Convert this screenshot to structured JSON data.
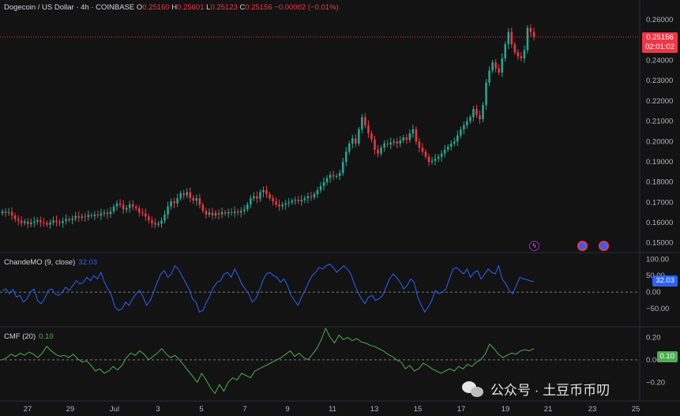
{
  "header": {
    "symbol": "Dogecoin / US Dollar · 4h · COINBASE",
    "o_label": "O",
    "o_value": "0.25160",
    "h_label": "H",
    "h_value": "0.25601",
    "l_label": "L",
    "l_value": "0.25123",
    "c_label": "C",
    "c_value": "0.25156",
    "change": "−0.00002 (−0.01%)"
  },
  "price_badge": {
    "price": "0.25156",
    "countdown": "02:01:02"
  },
  "chande": {
    "label": "ChandeMO (9, close)",
    "value": "32.03"
  },
  "cmf": {
    "label": "CMF (20)",
    "value": "0.10"
  },
  "watermark": "公众号 · 土豆币币叨",
  "colors": {
    "up": "#22ab94",
    "down": "#f23645",
    "chande": "#2962ff",
    "cmf": "#4caf50",
    "background": "#131313"
  },
  "chart_data": [
    {
      "type": "candlestick",
      "title": "Dogecoin / US Dollar · 4h · COINBASE",
      "yaxis": {
        "ticks": [
          "0.26000",
          "0.25000",
          "0.24000",
          "0.23000",
          "0.22000",
          "0.21000",
          "0.20000",
          "0.19000",
          "0.18000",
          "0.17000",
          "0.16000",
          "0.15000"
        ],
        "range": [
          0.146,
          0.262
        ]
      },
      "x_ticks": [
        "27",
        "29",
        "Jul",
        "3",
        "5",
        "7",
        "9",
        "11",
        "13",
        "15",
        "17",
        "19",
        "21",
        "23",
        "25"
      ],
      "last_price": 0.25156,
      "closes": [
        0.1655,
        0.1648,
        0.1652,
        0.1635,
        0.1618,
        0.161,
        0.1598,
        0.1606,
        0.1592,
        0.16,
        0.1605,
        0.1612,
        0.1602,
        0.1598,
        0.159,
        0.16,
        0.161,
        0.1603,
        0.1598,
        0.1608,
        0.1618,
        0.1612,
        0.162,
        0.1632,
        0.1625,
        0.163,
        0.1628,
        0.1638,
        0.1632,
        0.164,
        0.1635,
        0.1645,
        0.165,
        0.1642,
        0.1655,
        0.168,
        0.1695,
        0.1688,
        0.1665,
        0.1672,
        0.169,
        0.1678,
        0.167,
        0.165,
        0.1645,
        0.163,
        0.1612,
        0.1598,
        0.159,
        0.1595,
        0.161,
        0.164,
        0.168,
        0.1705,
        0.1695,
        0.172,
        0.1745,
        0.1735,
        0.175,
        0.1722,
        0.1708,
        0.172,
        0.1688,
        0.1658,
        0.164,
        0.165,
        0.1636,
        0.1648,
        0.164,
        0.1652,
        0.1645,
        0.1652,
        0.1648,
        0.1655,
        0.165,
        0.1658,
        0.1665,
        0.169,
        0.172,
        0.173,
        0.1718,
        0.175,
        0.176,
        0.174,
        0.172,
        0.1705,
        0.169,
        0.168,
        0.1688,
        0.1695,
        0.17,
        0.1708,
        0.1712,
        0.1705,
        0.1712,
        0.172,
        0.173,
        0.1725,
        0.174,
        0.176,
        0.178,
        0.18,
        0.182,
        0.1835,
        0.1828,
        0.183,
        0.1845,
        0.19,
        0.195,
        0.199,
        0.2015,
        0.199,
        0.206,
        0.212,
        0.208,
        0.204,
        0.201,
        0.196,
        0.194,
        0.197,
        0.199,
        0.1985,
        0.1995,
        0.2,
        0.199,
        0.2005,
        0.202,
        0.2008,
        0.204,
        0.206,
        0.2,
        0.197,
        0.195,
        0.1925,
        0.19,
        0.1905,
        0.1915,
        0.1925,
        0.194,
        0.196,
        0.1975,
        0.199,
        0.2,
        0.203,
        0.206,
        0.208,
        0.21,
        0.212,
        0.216,
        0.213,
        0.211,
        0.218,
        0.229,
        0.235,
        0.239,
        0.236,
        0.234,
        0.241,
        0.248,
        0.254,
        0.248,
        0.244,
        0.242,
        0.241,
        0.245,
        0.256,
        0.254,
        0.2516
      ]
    },
    {
      "type": "line",
      "title": "ChandeMO (9, close)",
      "yaxis": {
        "ticks": [
          "100.00",
          "50.00",
          "0.00",
          "−50.00"
        ],
        "range": [
          -100,
          115
        ]
      },
      "values": [
        5,
        10,
        -5,
        8,
        -15,
        -10,
        -30,
        -20,
        0,
        10,
        -25,
        -35,
        -20,
        5,
        10,
        -5,
        -10,
        0,
        15,
        5,
        20,
        35,
        25,
        30,
        45,
        35,
        50,
        40,
        60,
        30,
        10,
        -10,
        -45,
        -55,
        -50,
        -30,
        -40,
        -20,
        -5,
        5,
        -15,
        -40,
        -25,
        0,
        30,
        55,
        65,
        45,
        55,
        80,
        70,
        50,
        30,
        10,
        -20,
        -30,
        -60,
        -55,
        -30,
        -10,
        15,
        30,
        35,
        55,
        60,
        45,
        70,
        50,
        25,
        10,
        -5,
        -30,
        -20,
        5,
        35,
        55,
        60,
        50,
        45,
        30,
        40,
        20,
        -10,
        -25,
        -40,
        -15,
        5,
        30,
        50,
        60,
        75,
        70,
        80,
        85,
        75,
        60,
        70,
        80,
        70,
        55,
        25,
        0,
        -20,
        -35,
        -15,
        -10,
        -25,
        -20,
        -10,
        15,
        40,
        55,
        45,
        30,
        10,
        20,
        40,
        30,
        -15,
        -40,
        -60,
        -45,
        -25,
        5,
        -5,
        0,
        10,
        40,
        70,
        75,
        65,
        55,
        70,
        45,
        60,
        65,
        40,
        55,
        70,
        60,
        55,
        80,
        40,
        25,
        5,
        -5,
        20,
        45,
        40,
        38,
        34,
        32.03
      ]
    },
    {
      "type": "line",
      "title": "CMF (20)",
      "yaxis": {
        "ticks": [
          "0.20",
          "0.00",
          "−0.20"
        ],
        "range": [
          -0.36,
          0.28
        ]
      },
      "values": [
        0.0,
        0.02,
        0.05,
        0.03,
        0.06,
        0.04,
        0.07,
        0.05,
        0.02,
        0.06,
        0.12,
        0.08,
        0.05,
        0.03,
        0.04,
        0.02,
        0.05,
        0.01,
        -0.02,
        -0.01,
        -0.05,
        -0.1,
        -0.08,
        -0.12,
        -0.1,
        -0.06,
        -0.09,
        -0.05,
        0.02,
        0.06,
        0.04,
        0.08,
        0.05,
        0.0,
        0.03,
        0.06,
        0.1,
        0.05,
        0.02,
        0.04,
        0.0,
        -0.05,
        -0.1,
        -0.15,
        -0.2,
        -0.12,
        -0.18,
        -0.25,
        -0.3,
        -0.22,
        -0.28,
        -0.2,
        -0.16,
        -0.18,
        -0.12,
        -0.14,
        -0.16,
        -0.1,
        -0.08,
        -0.06,
        -0.04,
        -0.02,
        0.0,
        0.02,
        0.05,
        0.08,
        0.03,
        0.06,
        0.02,
        0.0,
        0.05,
        0.1,
        0.18,
        0.28,
        0.2,
        0.15,
        0.22,
        0.18,
        0.2,
        0.17,
        0.19,
        0.16,
        0.15,
        0.13,
        0.12,
        0.1,
        0.08,
        0.05,
        0.03,
        0.0,
        -0.02,
        -0.08,
        -0.05,
        -0.1,
        -0.08,
        -0.03,
        -0.05,
        -0.08,
        -0.1,
        -0.12,
        -0.1,
        -0.08,
        -0.1,
        -0.06,
        -0.08,
        -0.04,
        -0.06,
        -0.02,
        0.0,
        0.05,
        0.14,
        0.1,
        0.05,
        0.02,
        0.04,
        0.06,
        0.05,
        0.08,
        0.09,
        0.08,
        0.1
      ]
    }
  ]
}
